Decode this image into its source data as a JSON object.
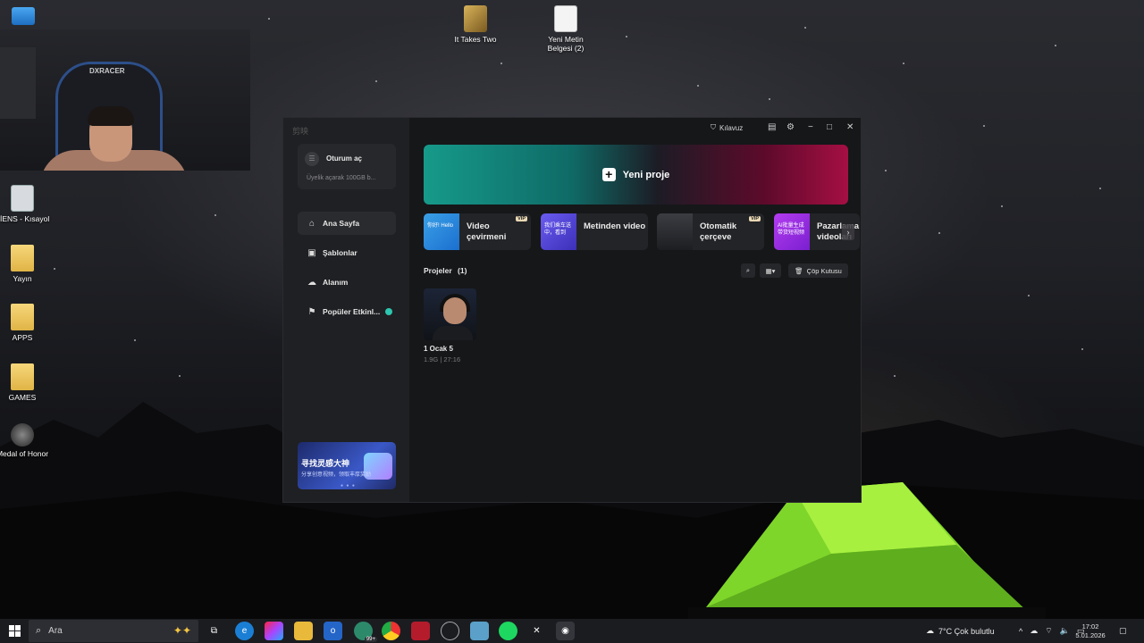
{
  "desktop": {
    "icons": [
      {
        "label": "It Takes Two"
      },
      {
        "label": "Yeni Metin Belgesi (2)"
      },
      {
        "label": "TİENS - Kısayol"
      },
      {
        "label": "Yayın"
      },
      {
        "label": "APPS"
      },
      {
        "label": "GAMES"
      },
      {
        "label": "Medal of Honor"
      }
    ]
  },
  "webcam": {
    "chair_label": "DXRACER"
  },
  "app": {
    "logo": "剪映",
    "sidebar": {
      "login_label": "Oturum aç",
      "login_sub": "Üyelik açarak 100GB b...",
      "nav": [
        {
          "label": "Ana Sayfa",
          "icon": "home-icon"
        },
        {
          "label": "Şablonlar",
          "icon": "template-icon"
        },
        {
          "label": "Alanım",
          "icon": "cloud-icon"
        },
        {
          "label": "Popüler Etkinl...",
          "icon": "flag-icon"
        }
      ],
      "promo": {
        "title": "寻找灵感大神",
        "subtitle": "分享创意视频，领取丰厚奖励",
        "dots": "● ● ●"
      }
    },
    "topbar": {
      "guide_label": "Kılavuz"
    },
    "new_project_label": "Yeni proje",
    "features": [
      {
        "label": "Video çevirmeni",
        "vip": "VIP",
        "thumb_text": "你好! Hello"
      },
      {
        "label": "Metinden video",
        "vip": "",
        "thumb_text": "我们乘车送\n中，看到"
      },
      {
        "label": "Otomatik çerçeve",
        "vip": "VIP",
        "thumb_text": ""
      },
      {
        "label": "Pazarlama videoları",
        "vip": "",
        "thumb_text": "AI批量生成\n带货短视频"
      }
    ],
    "projects": {
      "heading": "Projeler",
      "count": "(1)",
      "trash_label": "Çöp Kutusu",
      "items": [
        {
          "name": "1 Ocak 5",
          "meta": "1.9G | 27:16"
        }
      ]
    }
  },
  "taskbar": {
    "search_placeholder": "Ara",
    "badge": "99+",
    "weather": "7°C  Çok bulutlu",
    "time": "17:02",
    "date": "5.01.2026"
  },
  "colors": {
    "accent_teal": "#169a8a",
    "accent_red": "#a50f43",
    "app_bg": "#161719",
    "sidebar_bg": "#1f2023"
  }
}
